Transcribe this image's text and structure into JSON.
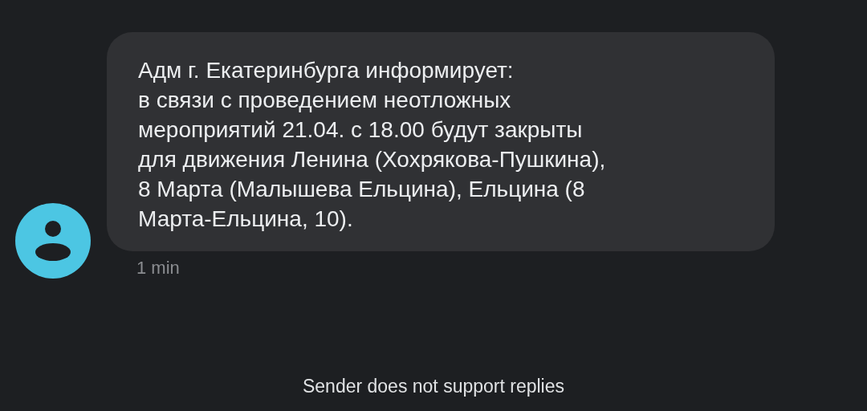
{
  "message": {
    "text": "Адм г. Екатеринбурга информирует:\nв связи с проведением неотложных\nмероприятий 21.04. с 18.00 будут закрыты\nдля движения Ленина (Хохрякова-Пушкина),\n8 Марта (Малышева Ельцина), Ельцина (8\nМарта-Ельцина, 10).",
    "time": "1 min"
  },
  "footer": "Sender does not support replies"
}
